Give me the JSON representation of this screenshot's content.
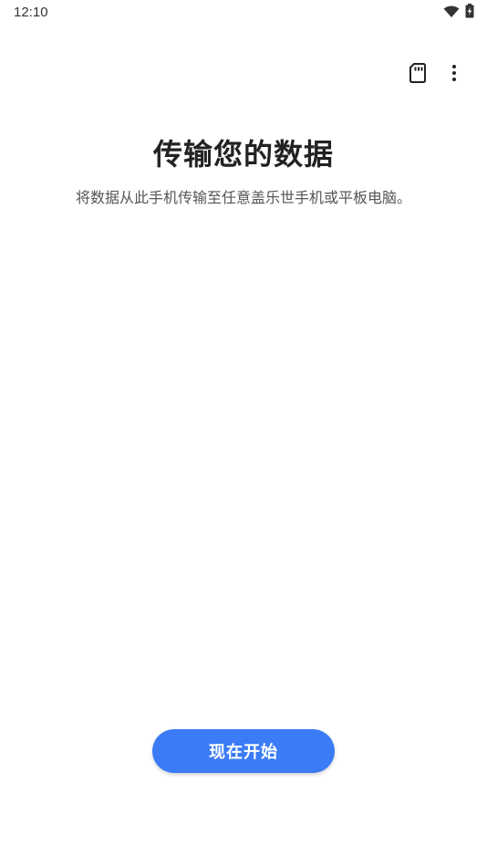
{
  "status_bar": {
    "time": "12:10",
    "icons": [
      "wifi-icon",
      "battery-charging-icon"
    ]
  },
  "toolbar": {
    "icons": [
      "sd-card-icon",
      "more-vert-icon"
    ]
  },
  "main": {
    "title": "传输您的数据",
    "subtitle": "将数据从此手机传输至任意盖乐世手机或平板电脑。"
  },
  "actions": {
    "start_label": "现在开始"
  },
  "colors": {
    "accent": "#3b7cf6",
    "background": "#ffffff",
    "title_text": "#222222",
    "subtitle_text": "#555555"
  }
}
